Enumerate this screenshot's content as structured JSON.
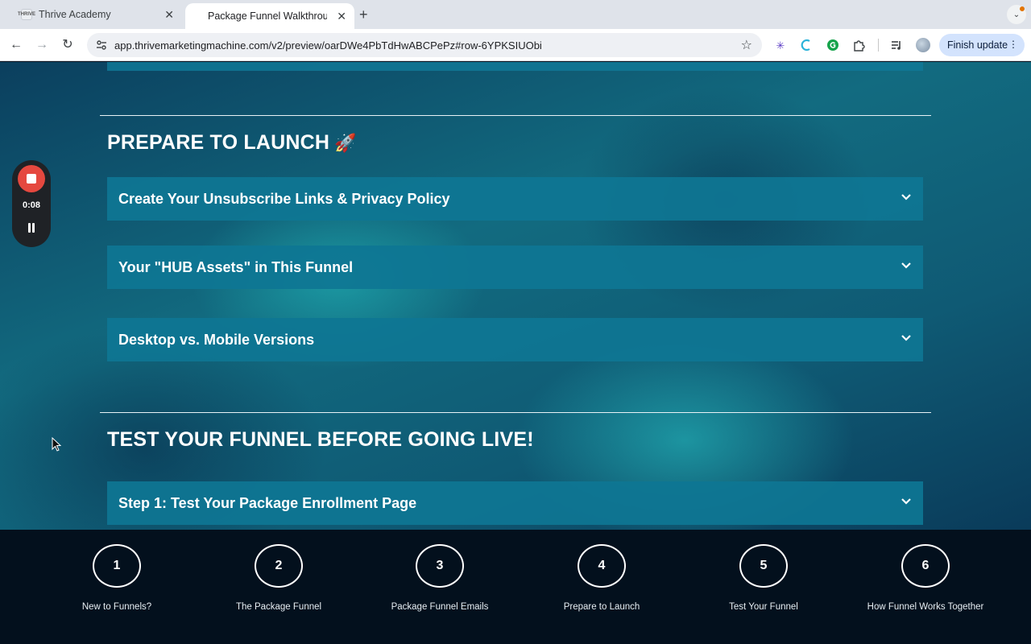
{
  "browser": {
    "tabs": [
      {
        "favicon_text": "THRIVE",
        "label": "Thrive Academy",
        "active": false
      },
      {
        "label": "Package Funnel Walkthrough",
        "active": true
      }
    ],
    "url": "app.thrivemarketingmachine.com/v2/preview/oarDWe4PbTdHwABCPePz#row-6YPKSIUObi",
    "finish_update_label": "Finish update"
  },
  "recorder": {
    "elapsed": "0:08"
  },
  "sections": [
    {
      "title": "PREPARE TO LAUNCH",
      "emoji": "🚀",
      "items": [
        "Create Your Unsubscribe Links & Privacy Policy",
        "Your \"HUB Assets\" in This Funnel",
        "Desktop vs. Mobile Versions"
      ]
    },
    {
      "title": "TEST YOUR FUNNEL BEFORE GOING LIVE!",
      "items": [
        "Step 1: Test Your Package Enrollment Page"
      ]
    }
  ],
  "steps": [
    {
      "number": "1",
      "label": "New to Funnels?"
    },
    {
      "number": "2",
      "label": "The Package Funnel"
    },
    {
      "number": "3",
      "label": "Package Funnel Emails"
    },
    {
      "number": "4",
      "label": "Prepare to Launch"
    },
    {
      "number": "5",
      "label": "Test Your Funnel"
    },
    {
      "number": "6",
      "label": "How Funnel Works Together"
    }
  ],
  "colors": {
    "recording_red": "#e5483f",
    "accordion_bg": "#0e7694",
    "bottom_nav_bg": "#03101d"
  }
}
